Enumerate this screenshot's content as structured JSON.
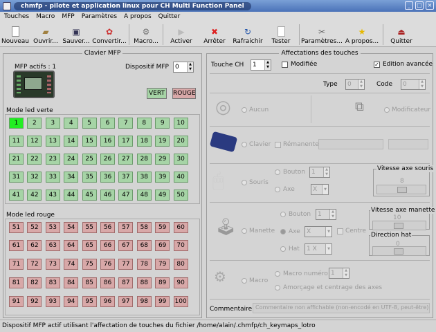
{
  "window": {
    "title": "chmfp - pilote et application linux pour CH Multi Function Panel"
  },
  "menu": [
    "Touches",
    "Macro",
    "MFP",
    "Paramètres",
    "A propos",
    "Quitter"
  ],
  "toolbar": [
    "Nouveau",
    "Ouvrir...",
    "Sauver...",
    "Convertir...",
    "Macro...",
    "Activer",
    "Arrêter",
    "Rafraichir",
    "Tester",
    "Paramètres...",
    "A propos...",
    "Quitter"
  ],
  "clavier": {
    "title": "Clavier MFP",
    "mfp_actifs": "MFP actifs : 1",
    "dispositif_label": "Dispositif MFP",
    "dispositif_value": "0",
    "vert": "VERT",
    "rouge": "ROUGE",
    "mode_verte": "Mode led verte",
    "mode_rouge": "Mode led rouge",
    "green_leds": [
      "1",
      "2",
      "3",
      "4",
      "5",
      "6",
      "7",
      "8",
      "9",
      "10",
      "11",
      "12",
      "13",
      "14",
      "15",
      "16",
      "17",
      "18",
      "19",
      "20",
      "21",
      "22",
      "23",
      "24",
      "25",
      "26",
      "27",
      "28",
      "29",
      "30",
      "31",
      "32",
      "33",
      "34",
      "35",
      "36",
      "37",
      "38",
      "39",
      "40",
      "41",
      "42",
      "43",
      "44",
      "45",
      "46",
      "47",
      "48",
      "49",
      "50"
    ],
    "red_leds": [
      "51",
      "52",
      "53",
      "54",
      "55",
      "56",
      "57",
      "58",
      "59",
      "60",
      "61",
      "62",
      "63",
      "64",
      "65",
      "66",
      "67",
      "68",
      "69",
      "70",
      "71",
      "72",
      "73",
      "74",
      "75",
      "76",
      "77",
      "78",
      "79",
      "80",
      "81",
      "82",
      "83",
      "84",
      "85",
      "86",
      "87",
      "88",
      "89",
      "90",
      "91",
      "92",
      "93",
      "94",
      "95",
      "96",
      "97",
      "98",
      "99",
      "100"
    ]
  },
  "affect": {
    "title": "Affectations des touches",
    "touche_label": "Touche CH",
    "touche_value": "1",
    "modifiee": "Modifiée",
    "edition": "Edition avancée",
    "type": "Type",
    "code": "Code",
    "type_value": "0",
    "code_value": "0",
    "aucun": "Aucun",
    "modificateur": "Modificateur",
    "clavier": "Clavier",
    "remanente": "Rémanente",
    "souris": "Souris",
    "bouton": "Bouton",
    "bouton_value": "1",
    "axe": "Axe",
    "axe_x": "X",
    "vitesse_souris": "Vitesse axe souris",
    "vs_value": "8",
    "manette": "Manette",
    "m_bouton_value": "1",
    "m_axe_x": "X",
    "centre": "Centre",
    "hat": "Hat",
    "hat_value": "1 X",
    "vitesse_manette": "Vitesse axe manette",
    "vm_value": "10",
    "direction_hat": "Direction hat",
    "dh_value": "0",
    "macro": "Macro",
    "macro_numero": "Macro numéro",
    "macro_value": "1",
    "amorcage": "Amorçage et centrage des axes",
    "commentaire": "Commentaire",
    "commentaire_placeholder": "Commentaire non affichable (non-encodé en UTF-8, peut-être)"
  },
  "status": "Dispositif MFP actif utilisant l'affectation de touches du fichier /home/alain/.chmfp/ch_keymaps_lotro"
}
